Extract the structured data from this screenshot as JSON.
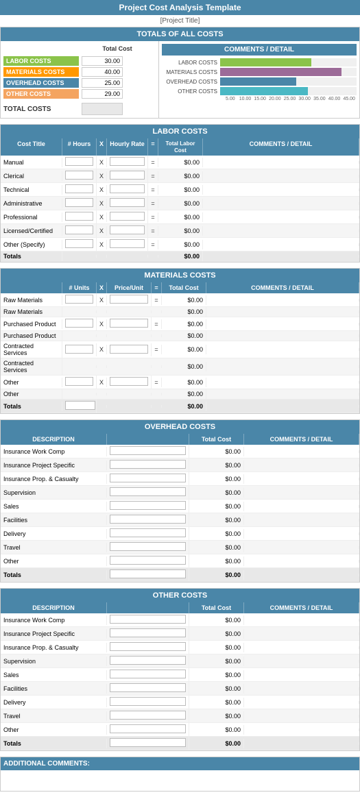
{
  "title": "Project Cost Analysis Template",
  "subtitle": "[Project Title]",
  "totals_section": {
    "header": "TOTALS OF ALL COSTS",
    "total_cost_label": "Total Cost",
    "comments_detail_label": "COMMENTS / DETAIL",
    "labor": {
      "label": "LABOR COSTS",
      "value": "30.00"
    },
    "materials": {
      "label": "MATERIALS COSTS",
      "value": "40.00"
    },
    "overhead": {
      "label": "OVERHEAD COSTS",
      "value": "25.00"
    },
    "other": {
      "label": "OTHER COSTS",
      "value": "29.00"
    },
    "total": {
      "label": "TOTAL COSTS",
      "value": ""
    },
    "chart": {
      "bars": [
        {
          "label": "LABOR COSTS",
          "value": 30,
          "max": 45,
          "color": "#8bc34a"
        },
        {
          "label": "MATERIALS COSTS",
          "value": 40,
          "max": 45,
          "color": "#9c6b98"
        },
        {
          "label": "OVERHEAD COSTS",
          "value": 25,
          "max": 45,
          "color": "#4a86a8"
        },
        {
          "label": "OTHER COSTS",
          "value": 29,
          "max": 45,
          "color": "#4ab8c4"
        }
      ],
      "axis": [
        "5.00",
        "10.00",
        "15.00",
        "20.00",
        "25.00",
        "30.00",
        "35.00",
        "40.00",
        "45.00"
      ]
    }
  },
  "labor_section": {
    "header": "LABOR COSTS",
    "columns": [
      "Cost Title",
      "# Hours",
      "X",
      "Hourly Rate",
      "=",
      "Total Labor Cost",
      "COMMENTS / DETAIL"
    ],
    "rows": [
      {
        "title": "Manual",
        "dollar": "$0.00"
      },
      {
        "title": "Clerical",
        "dollar": "$0.00"
      },
      {
        "title": "Technical",
        "dollar": "$0.00"
      },
      {
        "title": "Administrative",
        "dollar": "$0.00"
      },
      {
        "title": "Professional",
        "dollar": "$0.00"
      },
      {
        "title": "Licensed/Certified",
        "dollar": "$0.00"
      },
      {
        "title": "Other (Specify)",
        "dollar": "$0.00"
      }
    ],
    "totals_label": "Totals",
    "totals_value": "$0.00"
  },
  "materials_section": {
    "header": "MATERIALS COSTS",
    "columns": [
      "",
      "# Units",
      "X",
      "Price/Unit",
      "=",
      "Total Cost",
      "COMMENTS / DETAIL"
    ],
    "rows": [
      {
        "title": "Raw Materials",
        "dollar": "$0.00",
        "has_x": true
      },
      {
        "title": "Raw Materials",
        "dollar": "$0.00",
        "has_x": false
      },
      {
        "title": "Purchased Product",
        "dollar": "$0.00",
        "has_x": true
      },
      {
        "title": "Purchased Product",
        "dollar": "$0.00",
        "has_x": false
      },
      {
        "title": "Contracted Services",
        "dollar": "$0.00",
        "has_x": true
      },
      {
        "title": "Contracted Services",
        "dollar": "$0.00",
        "has_x": false
      },
      {
        "title": "Other",
        "dollar": "$0.00",
        "has_x": true
      },
      {
        "title": "Other",
        "dollar": "$0.00",
        "has_x": false
      }
    ],
    "totals_label": "Totals",
    "totals_value": "$0.00"
  },
  "overhead_section": {
    "header": "OVERHEAD COSTS",
    "columns": [
      "DESCRIPTION",
      "",
      "Total Cost",
      "COMMENTS / DETAIL"
    ],
    "rows": [
      {
        "title": "Insurance Work Comp",
        "dollar": "$0.00"
      },
      {
        "title": "Insurance Project Specific",
        "dollar": "$0.00"
      },
      {
        "title": "Insurance Prop. & Casualty",
        "dollar": "$0.00"
      },
      {
        "title": "Supervision",
        "dollar": "$0.00"
      },
      {
        "title": "Sales",
        "dollar": "$0.00"
      },
      {
        "title": "Facilities",
        "dollar": "$0.00"
      },
      {
        "title": "Delivery",
        "dollar": "$0.00"
      },
      {
        "title": "Travel",
        "dollar": "$0.00"
      },
      {
        "title": "Other",
        "dollar": "$0.00"
      }
    ],
    "totals_label": "Totals",
    "totals_value": "$0.00"
  },
  "other_section": {
    "header": "OTHER COSTS",
    "columns": [
      "DESCRIPTION",
      "",
      "Total Cost",
      "COMMENTS / DETAIL"
    ],
    "rows": [
      {
        "title": "Insurance Work Comp",
        "dollar": "$0.00"
      },
      {
        "title": "Insurance Project Specific",
        "dollar": "$0.00"
      },
      {
        "title": "Insurance Prop. & Casualty",
        "dollar": "$0.00"
      },
      {
        "title": "Supervision",
        "dollar": "$0.00"
      },
      {
        "title": "Sales",
        "dollar": "$0.00"
      },
      {
        "title": "Facilities",
        "dollar": "$0.00"
      },
      {
        "title": "Delivery",
        "dollar": "$0.00"
      },
      {
        "title": "Travel",
        "dollar": "$0.00"
      },
      {
        "title": "Other",
        "dollar": "$0.00"
      }
    ],
    "totals_label": "Totals",
    "totals_value": "$0.00"
  },
  "additional_comments": {
    "label": "ADDITIONAL COMMENTS:"
  }
}
